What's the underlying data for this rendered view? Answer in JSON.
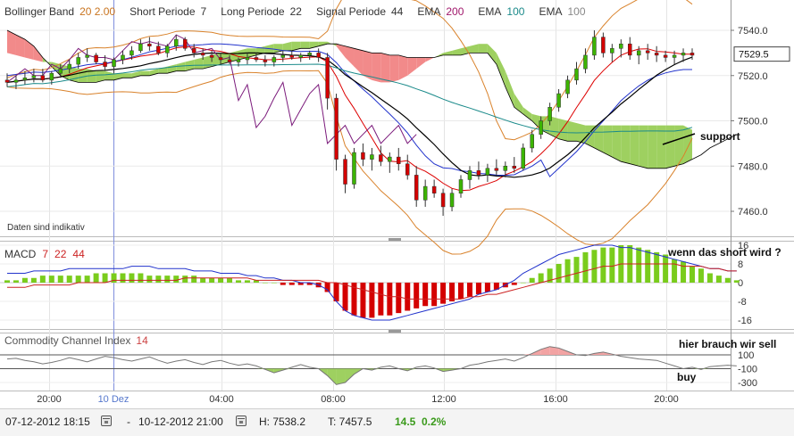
{
  "main_panel": {
    "legend": [
      {
        "name": "Bollinger Band",
        "params": "20  2.00",
        "param_color": "#c9741f"
      },
      {
        "name": "Short Periode",
        "params": "7",
        "param_color": "#333333"
      },
      {
        "name": "Long Periode",
        "params": "22",
        "param_color": "#333333"
      },
      {
        "name": "Signal Periode",
        "params": "44",
        "param_color": "#333333"
      },
      {
        "name": "EMA",
        "params": "200",
        "param_color": "#a0176b"
      },
      {
        "name": "EMA",
        "params": "100",
        "param_color": "#1a8a8a"
      },
      {
        "name": "EMA",
        "params": "100",
        "param_color": "#888888"
      }
    ],
    "indicative_note": "Daten sind indikativ",
    "y_ticks": [
      "7540.0",
      "7520.0",
      "7500.0",
      "7480.0",
      "7460.0"
    ],
    "last_price": "7529.5",
    "annotation_support": "support"
  },
  "macd_panel": {
    "title": "MACD",
    "params": [
      "7",
      "22",
      "44"
    ],
    "y_ticks": [
      "16",
      "8",
      "0",
      "-8",
      "-16"
    ],
    "annotation": "wenn das short wird ?"
  },
  "cci_panel": {
    "title": "Commodity Channel Index",
    "param": "14",
    "y_ticks": [
      "100",
      "-100",
      "-300"
    ],
    "annotation_sell": "hier brauch wir sell",
    "annotation_buy": "buy"
  },
  "x_axis": {
    "labels": [
      "20:00",
      "10 Dez",
      "04:00",
      "08:00",
      "12:00",
      "16:00",
      "20:00"
    ]
  },
  "bottom_bar": {
    "from": "07-12-2012 18:15",
    "separator": "-",
    "to": "10-12-2012 21:00",
    "high": "H: 7538.2",
    "low": "T: 7457.5",
    "change": "14.5",
    "change_pct": "0.2%"
  },
  "colors": {
    "up": "#3cb400",
    "down": "#d40000",
    "bb": "#d9822b",
    "ema200": "#7b1a7b",
    "ema100": "#1a8a8a",
    "blue": "#2233cc",
    "black": "#000000",
    "red": "#dd0000",
    "cloud_green": "#9ed060",
    "cloud_red": "#f28a8a"
  },
  "chart_data": [
    {
      "type": "candlestick",
      "title": "",
      "ylim": [
        7452,
        7548
      ],
      "x_labels": [
        "20:00",
        "10 Dez",
        "04:00",
        "08:00",
        "12:00",
        "16:00",
        "20:00"
      ],
      "candles_ohlc": [
        [
          7518,
          7521,
          7515,
          7517
        ],
        [
          7517,
          7520,
          7514,
          7518
        ],
        [
          7518,
          7522,
          7516,
          7519
        ],
        [
          7519,
          7523,
          7517,
          7520
        ],
        [
          7520,
          7523,
          7517,
          7518
        ],
        [
          7518,
          7522,
          7516,
          7521
        ],
        [
          7521,
          7525,
          7519,
          7523
        ],
        [
          7523,
          7527,
          7521,
          7525
        ],
        [
          7525,
          7530,
          7523,
          7528
        ],
        [
          7528,
          7532,
          7526,
          7529
        ],
        [
          7529,
          7530,
          7525,
          7526
        ],
        [
          7526,
          7529,
          7522,
          7524
        ],
        [
          7524,
          7528,
          7521,
          7527
        ],
        [
          7527,
          7531,
          7525,
          7529
        ],
        [
          7529,
          7533,
          7527,
          7531
        ],
        [
          7531,
          7536,
          7530,
          7534
        ],
        [
          7534,
          7537,
          7531,
          7533
        ],
        [
          7533,
          7535,
          7529,
          7530
        ],
        [
          7530,
          7534,
          7528,
          7533
        ],
        [
          7533,
          7538,
          7531,
          7536
        ],
        [
          7536,
          7537,
          7531,
          7532
        ],
        [
          7532,
          7534,
          7528,
          7530
        ],
        [
          7530,
          7532,
          7527,
          7529
        ],
        [
          7529,
          7531,
          7526,
          7528
        ],
        [
          7528,
          7530,
          7525,
          7527
        ],
        [
          7527,
          7529,
          7525,
          7526
        ],
        [
          7526,
          7528,
          7524,
          7527
        ],
        [
          7527,
          7530,
          7525,
          7528
        ],
        [
          7528,
          7530,
          7526,
          7527
        ],
        [
          7527,
          7529,
          7524,
          7526
        ],
        [
          7526,
          7529,
          7524,
          7528
        ],
        [
          7528,
          7531,
          7526,
          7529
        ],
        [
          7529,
          7531,
          7527,
          7528
        ],
        [
          7528,
          7530,
          7526,
          7529
        ],
        [
          7529,
          7531,
          7527,
          7530
        ],
        [
          7530,
          7532,
          7526,
          7528
        ],
        [
          7528,
          7530,
          7505,
          7510
        ],
        [
          7510,
          7512,
          7478,
          7483
        ],
        [
          7483,
          7485,
          7468,
          7472
        ],
        [
          7472,
          7488,
          7470,
          7486
        ],
        [
          7486,
          7490,
          7480,
          7483
        ],
        [
          7483,
          7488,
          7478,
          7485
        ],
        [
          7485,
          7489,
          7480,
          7482
        ],
        [
          7482,
          7486,
          7477,
          7484
        ],
        [
          7484,
          7488,
          7478,
          7481
        ],
        [
          7481,
          7485,
          7474,
          7476
        ],
        [
          7476,
          7480,
          7462,
          7465
        ],
        [
          7465,
          7474,
          7462,
          7471
        ],
        [
          7471,
          7474,
          7466,
          7468
        ],
        [
          7468,
          7470,
          7458,
          7462
        ],
        [
          7462,
          7470,
          7460,
          7468
        ],
        [
          7468,
          7476,
          7466,
          7474
        ],
        [
          7474,
          7480,
          7470,
          7478
        ],
        [
          7478,
          7482,
          7474,
          7476
        ],
        [
          7476,
          7481,
          7473,
          7479
        ],
        [
          7479,
          7483,
          7476,
          7478
        ],
        [
          7478,
          7482,
          7475,
          7480
        ],
        [
          7480,
          7484,
          7477,
          7479
        ],
        [
          7479,
          7490,
          7478,
          7488
        ],
        [
          7488,
          7496,
          7486,
          7494
        ],
        [
          7494,
          7502,
          7492,
          7500
        ],
        [
          7500,
          7508,
          7498,
          7506
        ],
        [
          7506,
          7514,
          7504,
          7512
        ],
        [
          7512,
          7520,
          7510,
          7518
        ],
        [
          7518,
          7526,
          7516,
          7523
        ],
        [
          7523,
          7532,
          7521,
          7529
        ],
        [
          7529,
          7540,
          7527,
          7537
        ],
        [
          7537,
          7539,
          7528,
          7530
        ],
        [
          7530,
          7534,
          7526,
          7532
        ],
        [
          7532,
          7536,
          7528,
          7534
        ],
        [
          7534,
          7537,
          7527,
          7529
        ],
        [
          7529,
          7533,
          7525,
          7531
        ],
        [
          7531,
          7534,
          7527,
          7530
        ],
        [
          7530,
          7533,
          7526,
          7529
        ],
        [
          7529,
          7531,
          7526,
          7528
        ],
        [
          7528,
          7531,
          7525,
          7529
        ],
        [
          7529,
          7532,
          7526,
          7530
        ],
        [
          7530,
          7532,
          7527,
          7529
        ]
      ]
    },
    {
      "type": "bar",
      "title": "MACD",
      "ylim": [
        -16,
        16
      ],
      "histogram": [
        1,
        1,
        2,
        2,
        3,
        3,
        3,
        3,
        3,
        3,
        4,
        4,
        4,
        4,
        4,
        4,
        3,
        3,
        3,
        3,
        3,
        3,
        2,
        2,
        2,
        2,
        1,
        1,
        1,
        0,
        0,
        -1,
        -1,
        -1,
        -1,
        -2,
        -4,
        -8,
        -12,
        -14,
        -15,
        -15,
        -14,
        -14,
        -13,
        -12,
        -11,
        -10,
        -10,
        -9,
        -8,
        -7,
        -6,
        -5,
        -4,
        -3,
        -2,
        -1,
        0,
        2,
        4,
        6,
        8,
        10,
        11,
        13,
        14,
        15,
        15,
        16,
        16,
        15,
        14,
        13,
        12,
        10,
        9,
        7,
        6,
        4,
        3,
        2,
        1
      ],
      "series": [
        {
          "name": "7",
          "values": [
            4,
            4,
            4,
            5,
            5,
            5,
            5,
            6,
            6,
            6,
            6,
            6,
            6,
            6,
            7,
            7,
            7,
            6,
            6,
            6,
            6,
            5,
            5,
            5,
            4,
            4,
            4,
            3,
            3,
            2,
            2,
            1,
            1,
            0,
            0,
            -1,
            -3,
            -8,
            -12,
            -14,
            -15,
            -16,
            -16,
            -16,
            -15,
            -14,
            -13,
            -12,
            -11,
            -10,
            -9,
            -8,
            -7,
            -5,
            -4,
            -3,
            -1,
            1,
            4,
            6,
            8,
            10,
            12,
            13,
            14,
            15,
            16,
            16,
            16,
            15,
            15,
            14,
            13,
            12,
            11,
            10,
            9,
            8,
            7,
            6,
            6,
            5,
            5
          ]
        },
        {
          "name": "22",
          "values": [
            -2,
            -2,
            -2,
            -1,
            -1,
            -1,
            -1,
            -1,
            0,
            0,
            0,
            0,
            1,
            1,
            1,
            1,
            1,
            1,
            1,
            1,
            2,
            2,
            2,
            2,
            2,
            2,
            2,
            2,
            1,
            1,
            1,
            1,
            1,
            1,
            1,
            1,
            0,
            0,
            -1,
            -2,
            -3,
            -4,
            -5,
            -6,
            -6,
            -7,
            -7,
            -7,
            -7,
            -7,
            -7,
            -7,
            -6,
            -6,
            -5,
            -5,
            -4,
            -3,
            -2,
            -1,
            0,
            1,
            2,
            3,
            4,
            5,
            6,
            7,
            7,
            8,
            8,
            8,
            8,
            8,
            8,
            8,
            7,
            7,
            7,
            6,
            6,
            5,
            5
          ]
        }
      ]
    },
    {
      "type": "area",
      "title": "Commodity Channel Index",
      "ylim": [
        -300,
        300
      ],
      "levels": [
        100,
        -100
      ],
      "series": [
        {
          "name": "14",
          "values": [
            40,
            50,
            20,
            0,
            -30,
            -10,
            20,
            60,
            30,
            0,
            40,
            80,
            60,
            30,
            10,
            40,
            70,
            20,
            -20,
            10,
            30,
            -10,
            -40,
            0,
            20,
            -20,
            -50,
            -30,
            -60,
            -110,
            -160,
            -120,
            -80,
            -40,
            -80,
            -100,
            -200,
            -330,
            -300,
            -180,
            -100,
            -120,
            -80,
            -60,
            -100,
            -130,
            -80,
            -60,
            -90,
            -140,
            -120,
            -100,
            -50,
            -30,
            0,
            20,
            40,
            10,
            60,
            120,
            180,
            220,
            200,
            150,
            100,
            90,
            120,
            140,
            110,
            80,
            60,
            40,
            30,
            20,
            -20,
            -60,
            -100,
            -80,
            -110,
            -70,
            -60,
            -50,
            -60
          ]
        }
      ]
    }
  ]
}
